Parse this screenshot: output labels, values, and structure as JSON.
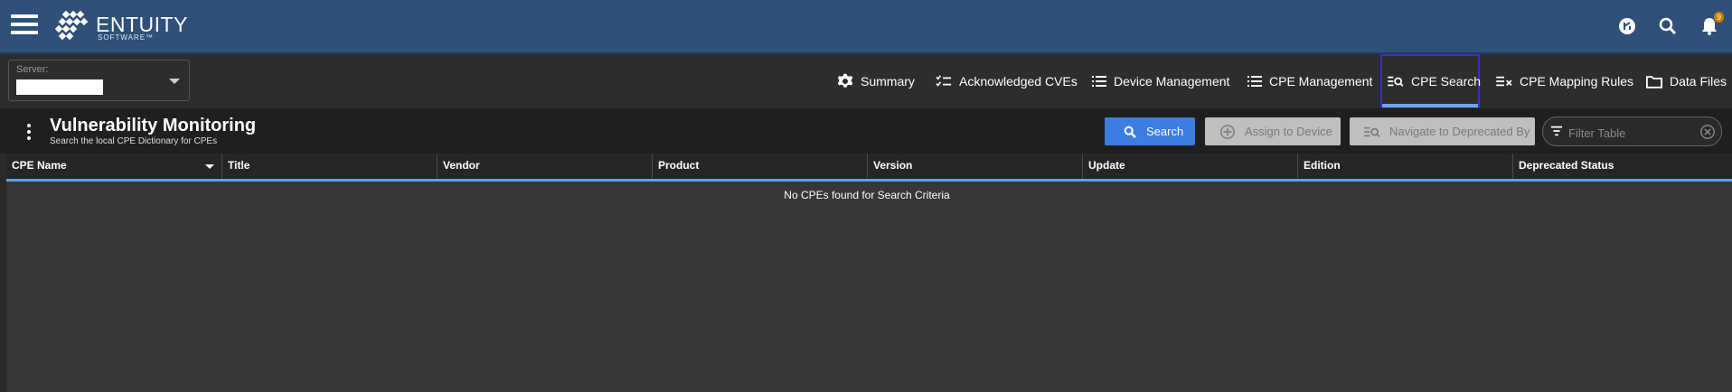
{
  "app": {
    "logo_text": "ENTUITY",
    "logo_subtext": "SOFTWARE™",
    "notification_count": "9"
  },
  "server": {
    "label": "Server:",
    "value": ""
  },
  "nav": {
    "tabs": [
      {
        "label": "Summary",
        "icon": "gear-icon"
      },
      {
        "label": "Acknowledged CVEs",
        "icon": "checklist-icon"
      },
      {
        "label": "Device Management",
        "icon": "list-icon"
      },
      {
        "label": "CPE Management",
        "icon": "list-icon"
      },
      {
        "label": "CPE Search",
        "icon": "list-search-icon",
        "active": true
      },
      {
        "label": "CPE Mapping Rules",
        "icon": "list-remove-icon"
      },
      {
        "label": "Data Files",
        "icon": "folder-icon"
      }
    ]
  },
  "header": {
    "title": "Vulnerability Monitoring",
    "subtitle": "Search the local CPE Dictionary for CPEs",
    "search_button": "Search",
    "assign_button": "Assign to Device",
    "navigate_button": "Navigate to Deprecated By",
    "filter_placeholder": "Filter Table"
  },
  "table": {
    "columns": [
      "CPE Name",
      "Title",
      "Vendor",
      "Product",
      "Version",
      "Update",
      "Edition",
      "Deprecated Status"
    ],
    "empty_message": "No CPEs found for Search Criteria"
  },
  "colors": {
    "topbar": "#2e5079",
    "accent_blue": "#3b7de0",
    "active_tab_border": "#3b2fc9",
    "table_underline": "#5aa2e6"
  }
}
